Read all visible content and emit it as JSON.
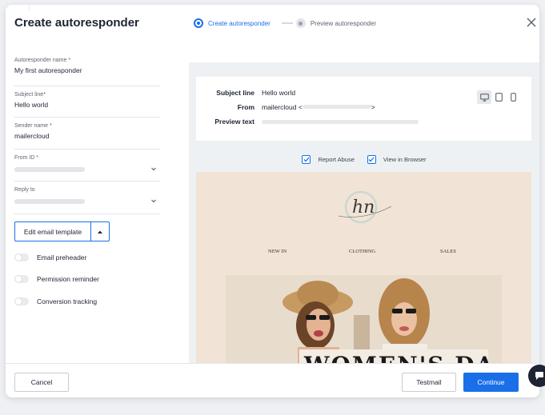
{
  "modal": {
    "title": "Create autoresponder",
    "steps": [
      {
        "label": "Create autoresponder",
        "state": "active"
      },
      {
        "label": "Preview autoresponder",
        "state": "inactive"
      }
    ]
  },
  "form": {
    "name": {
      "label": "Autoresponder name *",
      "value": "My first autoresponder"
    },
    "subject": {
      "label": "Subject line*",
      "value": "Hello world"
    },
    "sender": {
      "label": "Sender name *",
      "value": "mailercloud"
    },
    "from_id": {
      "label": "From ID *"
    },
    "reply_to": {
      "label": "Reply to"
    },
    "edit_template_label": "Edit email template",
    "toggles": [
      {
        "label": "Email preheader",
        "on": false
      },
      {
        "label": "Permission reminder",
        "on": false
      },
      {
        "label": "Conversion tracking",
        "on": false
      }
    ]
  },
  "preview": {
    "subject_key": "Subject line",
    "subject_value": "Hello world",
    "from_key": "From",
    "from_value_start": "mailercloud <",
    "from_value_end": ">",
    "preview_key": "Preview text",
    "devices": [
      "desktop-icon",
      "tablet-icon",
      "mobile-icon"
    ],
    "checks": [
      {
        "label": "Report Abuse",
        "checked": true
      },
      {
        "label": "View in Browser",
        "checked": true
      }
    ],
    "email": {
      "logo_text": "hn",
      "nav": [
        "NEW IN",
        "CLOTHING",
        "SALES"
      ],
      "banner_text": "WOMEN'S DAY"
    }
  },
  "footer": {
    "cancel_label": "Cancel",
    "testmail_label": "Testmail",
    "continue_label": "Continue"
  },
  "colors": {
    "accent": "#1a6fe8",
    "email_bg": "#f1e4d6"
  }
}
